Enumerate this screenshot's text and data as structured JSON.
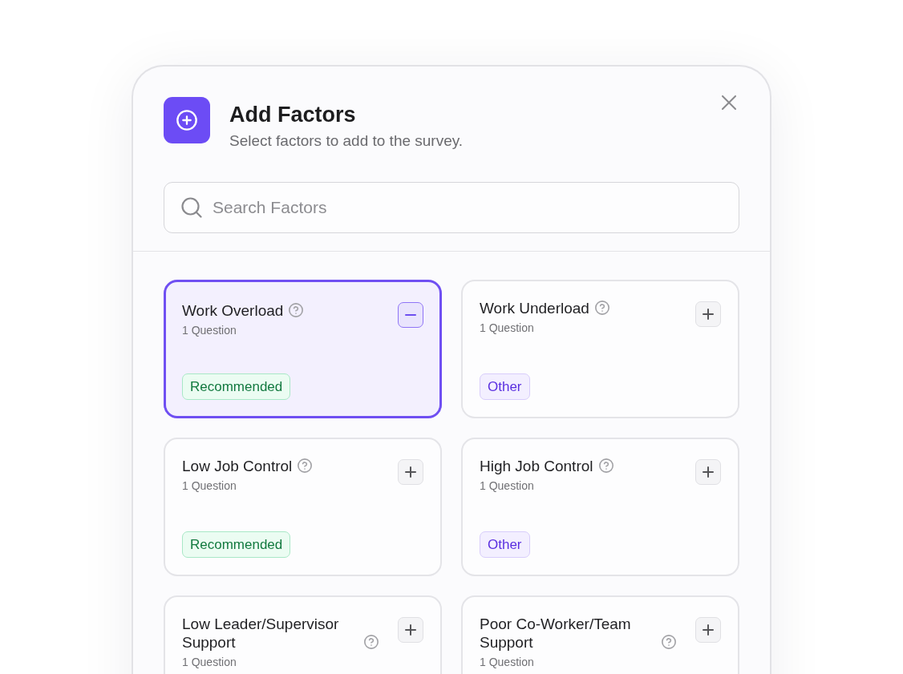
{
  "dialog": {
    "title": "Add Factors",
    "subtitle": "Select factors to add to the survey.",
    "search": {
      "placeholder": "Search Factors"
    }
  },
  "factors": [
    {
      "name": "Work Overload",
      "questions": "1 Question",
      "selected": true,
      "tag": {
        "label": "Recommended",
        "kind": "recommended"
      }
    },
    {
      "name": "Work Underload",
      "questions": "1 Question",
      "selected": false,
      "tag": {
        "label": "Other",
        "kind": "other"
      }
    },
    {
      "name": "Low Job Control",
      "questions": "1 Question",
      "selected": false,
      "tag": {
        "label": "Recommended",
        "kind": "recommended"
      }
    },
    {
      "name": "High Job Control",
      "questions": "1 Question",
      "selected": false,
      "tag": {
        "label": "Other",
        "kind": "other"
      }
    },
    {
      "name": "Low Leader/Supervisor Support",
      "questions": "1 Question",
      "selected": false
    },
    {
      "name": "Poor Co-Worker/Team Support",
      "questions": "1 Question",
      "selected": false
    }
  ]
}
